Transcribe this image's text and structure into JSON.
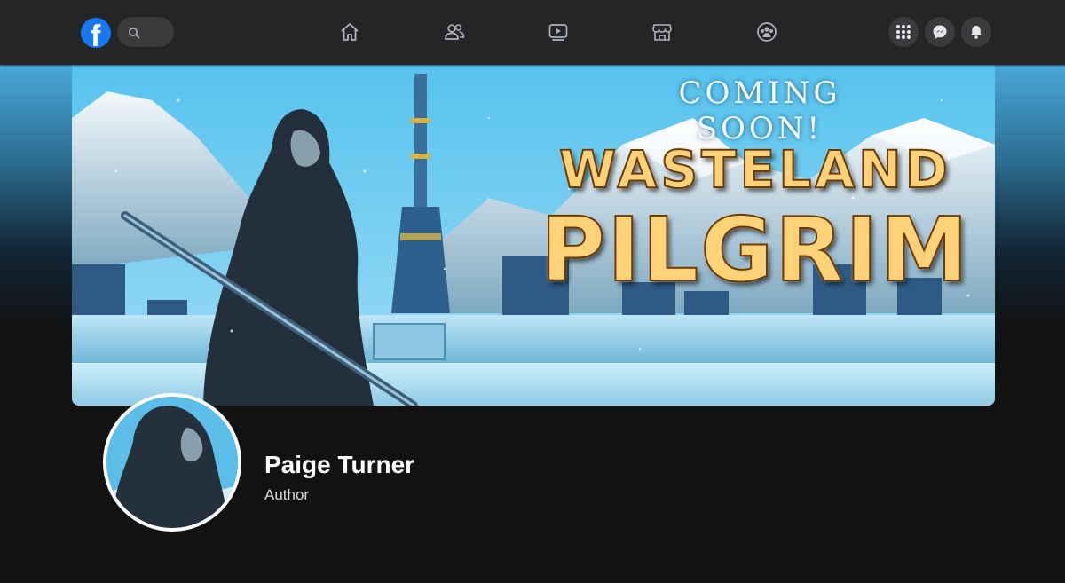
{
  "nav": {
    "logo_letter": "f",
    "icons": [
      "home-icon",
      "friends-icon",
      "watch-icon",
      "marketplace-icon",
      "groups-icon"
    ],
    "right_buttons": [
      "menu-grid-icon",
      "messenger-icon",
      "notifications-icon"
    ]
  },
  "cover": {
    "tagline": "COMING SOON!",
    "title_line1": "WASTELAND",
    "title_line2": "PILGRIM"
  },
  "profile": {
    "name": "Paige Turner",
    "subtitle": "Author"
  },
  "colors": {
    "nav_bg": "#242526",
    "page_bg": "#121212",
    "brand_blue": "#1877f2",
    "button_bg": "#3a3b3c"
  }
}
